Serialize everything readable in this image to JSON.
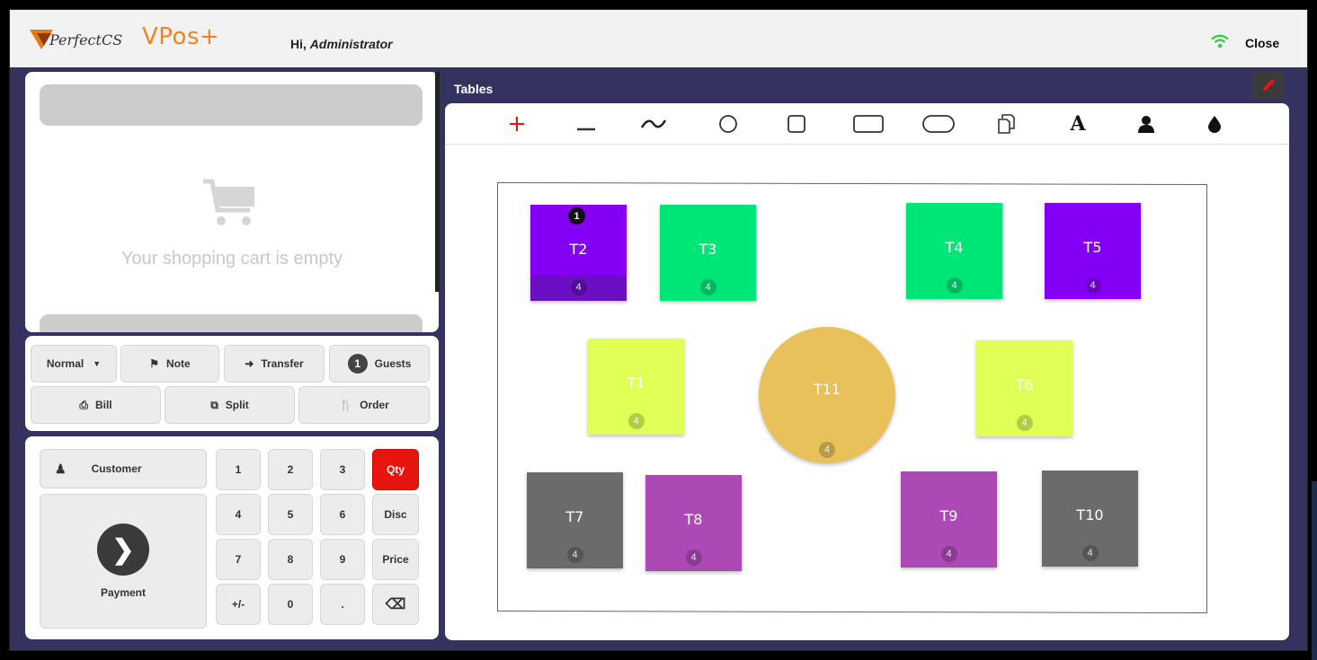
{
  "header": {
    "logo_text": "PerfectCS",
    "brand": "VPos+",
    "greeting_prefix": "Hi, ",
    "greeting_user": "Administrator",
    "close_label": "Close"
  },
  "cart": {
    "empty_message": "Your shopping cart is empty"
  },
  "actions": {
    "mode_label": "Normal",
    "note_label": "Note",
    "transfer_label": "Transfer",
    "guests_count": "1",
    "guests_label": "Guests",
    "bill_label": "Bill",
    "split_label": "Split",
    "order_label": "Order"
  },
  "keypad": {
    "customer_label": "Customer",
    "payment_label": "Payment",
    "keys": [
      "1",
      "2",
      "3",
      "Qty",
      "4",
      "5",
      "6",
      "Disc",
      "7",
      "8",
      "9",
      "Price",
      "+/-",
      "0",
      ".",
      "⌫"
    ]
  },
  "tables_panel": {
    "title": "Tables",
    "tools": [
      "add-icon",
      "line-icon",
      "curve-icon",
      "circle-icon",
      "square-icon",
      "rectangle-icon",
      "rounded-rectangle-icon",
      "copy-icon",
      "text-icon",
      "person-icon",
      "color-drop-icon"
    ]
  },
  "tables": [
    {
      "name": "T2",
      "seats": "4",
      "color": "#8400f5",
      "guests": "1"
    },
    {
      "name": "T3",
      "seats": "4",
      "color": "#00e676"
    },
    {
      "name": "T4",
      "seats": "4",
      "color": "#00e676"
    },
    {
      "name": "T5",
      "seats": "4",
      "color": "#8400f5"
    },
    {
      "name": "T1",
      "seats": "4",
      "color": "#e0ff57"
    },
    {
      "name": "T11",
      "seats": "4",
      "color": "#e8c15b",
      "shape": "round"
    },
    {
      "name": "T6",
      "seats": "4",
      "color": "#e0ff57"
    },
    {
      "name": "T7",
      "seats": "4",
      "color": "#6b6b6b"
    },
    {
      "name": "T8",
      "seats": "4",
      "color": "#ad49b5"
    },
    {
      "name": "T9",
      "seats": "4",
      "color": "#ad49b5"
    },
    {
      "name": "T10",
      "seats": "4",
      "color": "#6b6b6b"
    }
  ],
  "colors": {
    "frame": "#36325f",
    "accent_orange": "#f0851f",
    "qty_red": "#e8140f",
    "wifi_green": "#2ecc40"
  }
}
